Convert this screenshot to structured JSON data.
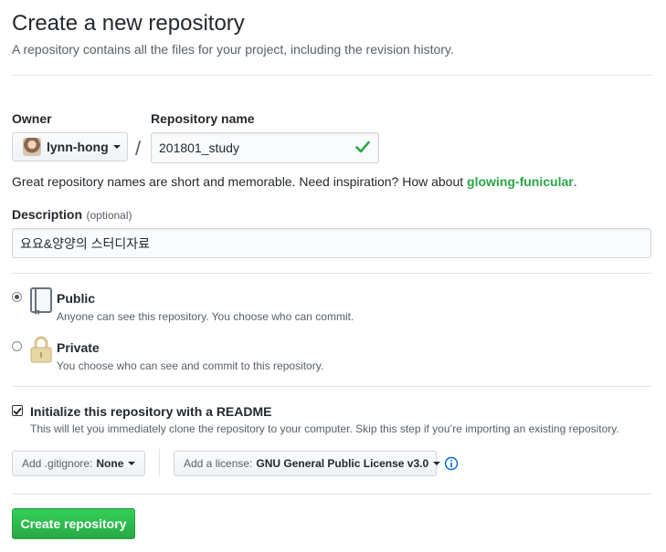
{
  "header": {
    "title": "Create a new repository",
    "subtitle": "A repository contains all the files for your project, including the revision history."
  },
  "owner": {
    "label": "Owner",
    "value": "lynn-hong"
  },
  "repo_name": {
    "label": "Repository name",
    "value": "201801_study"
  },
  "separator": "/",
  "hint": {
    "text": "Great repository names are short and memorable. Need inspiration? How about ",
    "suggestion": "glowing-funicular",
    "end": "."
  },
  "description": {
    "label": "Description",
    "optional": "(optional)",
    "value": "요요&양양의 스터디자료"
  },
  "visibility": {
    "public": {
      "title": "Public",
      "note": "Anyone can see this repository. You choose who can commit.",
      "selected": true,
      "icon": "repo-book-icon"
    },
    "private": {
      "title": "Private",
      "note": "You choose who can see and commit to this repository.",
      "selected": false,
      "icon": "lock-icon"
    }
  },
  "readme": {
    "checked": true,
    "title": "Initialize this repository with a README",
    "note": "This will let you immediately clone the repository to your computer. Skip this step if you’re importing an existing repository."
  },
  "gitignore": {
    "prefix": "Add .gitignore:",
    "value": "None"
  },
  "license": {
    "prefix": "Add a license:",
    "value": "GNU General Public License v3.0"
  },
  "create_button": "Create repository",
  "colors": {
    "accent_green": "#28a745",
    "text": "#24292e",
    "muted": "#586069",
    "info_blue": "#0366d6"
  }
}
